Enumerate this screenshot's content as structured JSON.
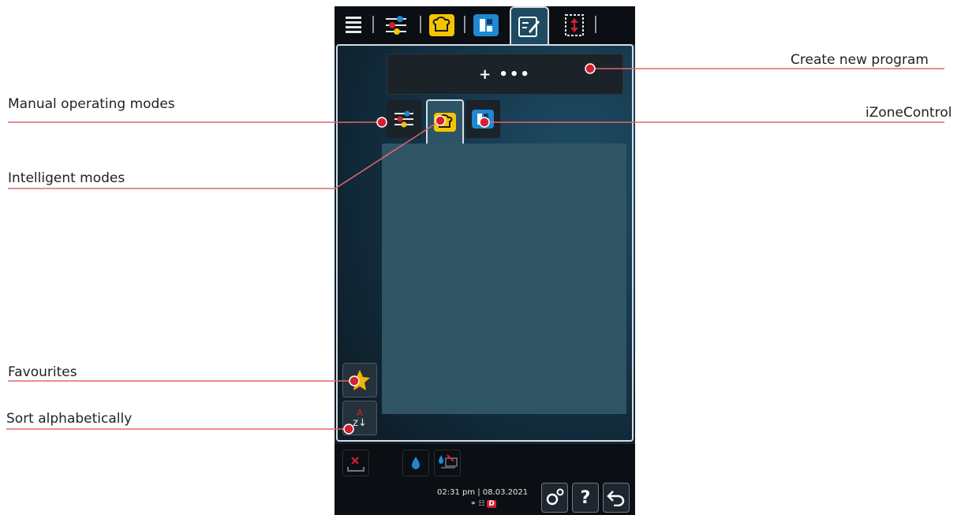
{
  "callouts": {
    "create_new_program": "Create new program",
    "manual_operating_modes": "Manual operating modes",
    "izonecontrol": "iZoneControl",
    "intelligent_modes": "Intelligent modes",
    "favourites": "Favourites",
    "sort_alphabetically": "Sort alphabetically"
  },
  "device": {
    "top_tabs": [
      "menu-icon",
      "manual-modes-icon",
      "intelligent-modes-icon",
      "izonecontrol-icon",
      "programming-icon",
      "autoloading-icon"
    ],
    "active_tab": "programming-icon",
    "create_button_label": "+ •••",
    "sub_tabs": [
      "manual-modes-icon",
      "intelligent-modes-icon",
      "izonecontrol-icon"
    ],
    "active_sub_tab": "intelligent-modes-icon",
    "sort_label": "z↓",
    "sort_label_top": "A",
    "footer": {
      "time": "02:31 pm",
      "date": "08.03.2021",
      "datetime_separator": "|",
      "status_badge": "D",
      "help_label": "?"
    }
  },
  "colors": {
    "callout_line": "#e0686a",
    "callout_dot": "#d5202f",
    "accent_yellow": "#f5c400",
    "accent_blue": "#1e88d2",
    "panel_bg": "#2f5565"
  }
}
